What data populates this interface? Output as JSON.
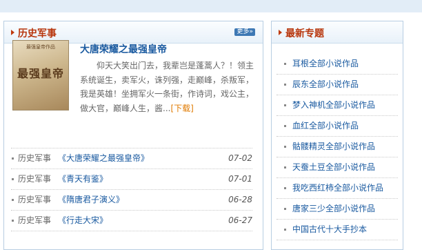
{
  "left_panel": {
    "title": "历史军事",
    "more_label": "更多»",
    "featured": {
      "cover_top": "最强皇帝作品",
      "cover_title": "最强皇帝",
      "cover_sub": "",
      "title": "大唐荣耀之最强皇帝",
      "description": "仰天大笑出门去，我辈岂是蓬蒿人？！领主系统诞生，卖军火，诛列强，走巅峰，杀叛军，我是英雄！坐拥军火一条街，作诗词，戏公主，做大官，巅峰人生，酱...",
      "download_label": "[下载]"
    },
    "items": [
      {
        "category": "历史军事",
        "title": "《大唐荣耀之最强皇帝》",
        "date": "07-02"
      },
      {
        "category": "历史军事",
        "title": "《青天有鉴》",
        "date": "07-01"
      },
      {
        "category": "历史军事",
        "title": "《隋唐君子演义》",
        "date": "06-28"
      },
      {
        "category": "历史军事",
        "title": "《行走大宋》",
        "date": "06-27"
      }
    ]
  },
  "right_panel": {
    "title": "最新专题",
    "topics": [
      "耳根全部小说作品",
      "辰东全部小说作品",
      "梦入神机全部小说作品",
      "血红全部小说作品",
      "骷髅精灵全部小说作品",
      "天蚕土豆全部小说作品",
      "我吃西红柿全部小说作品",
      "唐家三少全部小说作品",
      "中国古代十大手抄本"
    ]
  },
  "colors": {
    "accent_title": "#b8360c",
    "link": "#1a5aa0",
    "download": "#e07a00",
    "panel_border": "#b7cde2"
  }
}
